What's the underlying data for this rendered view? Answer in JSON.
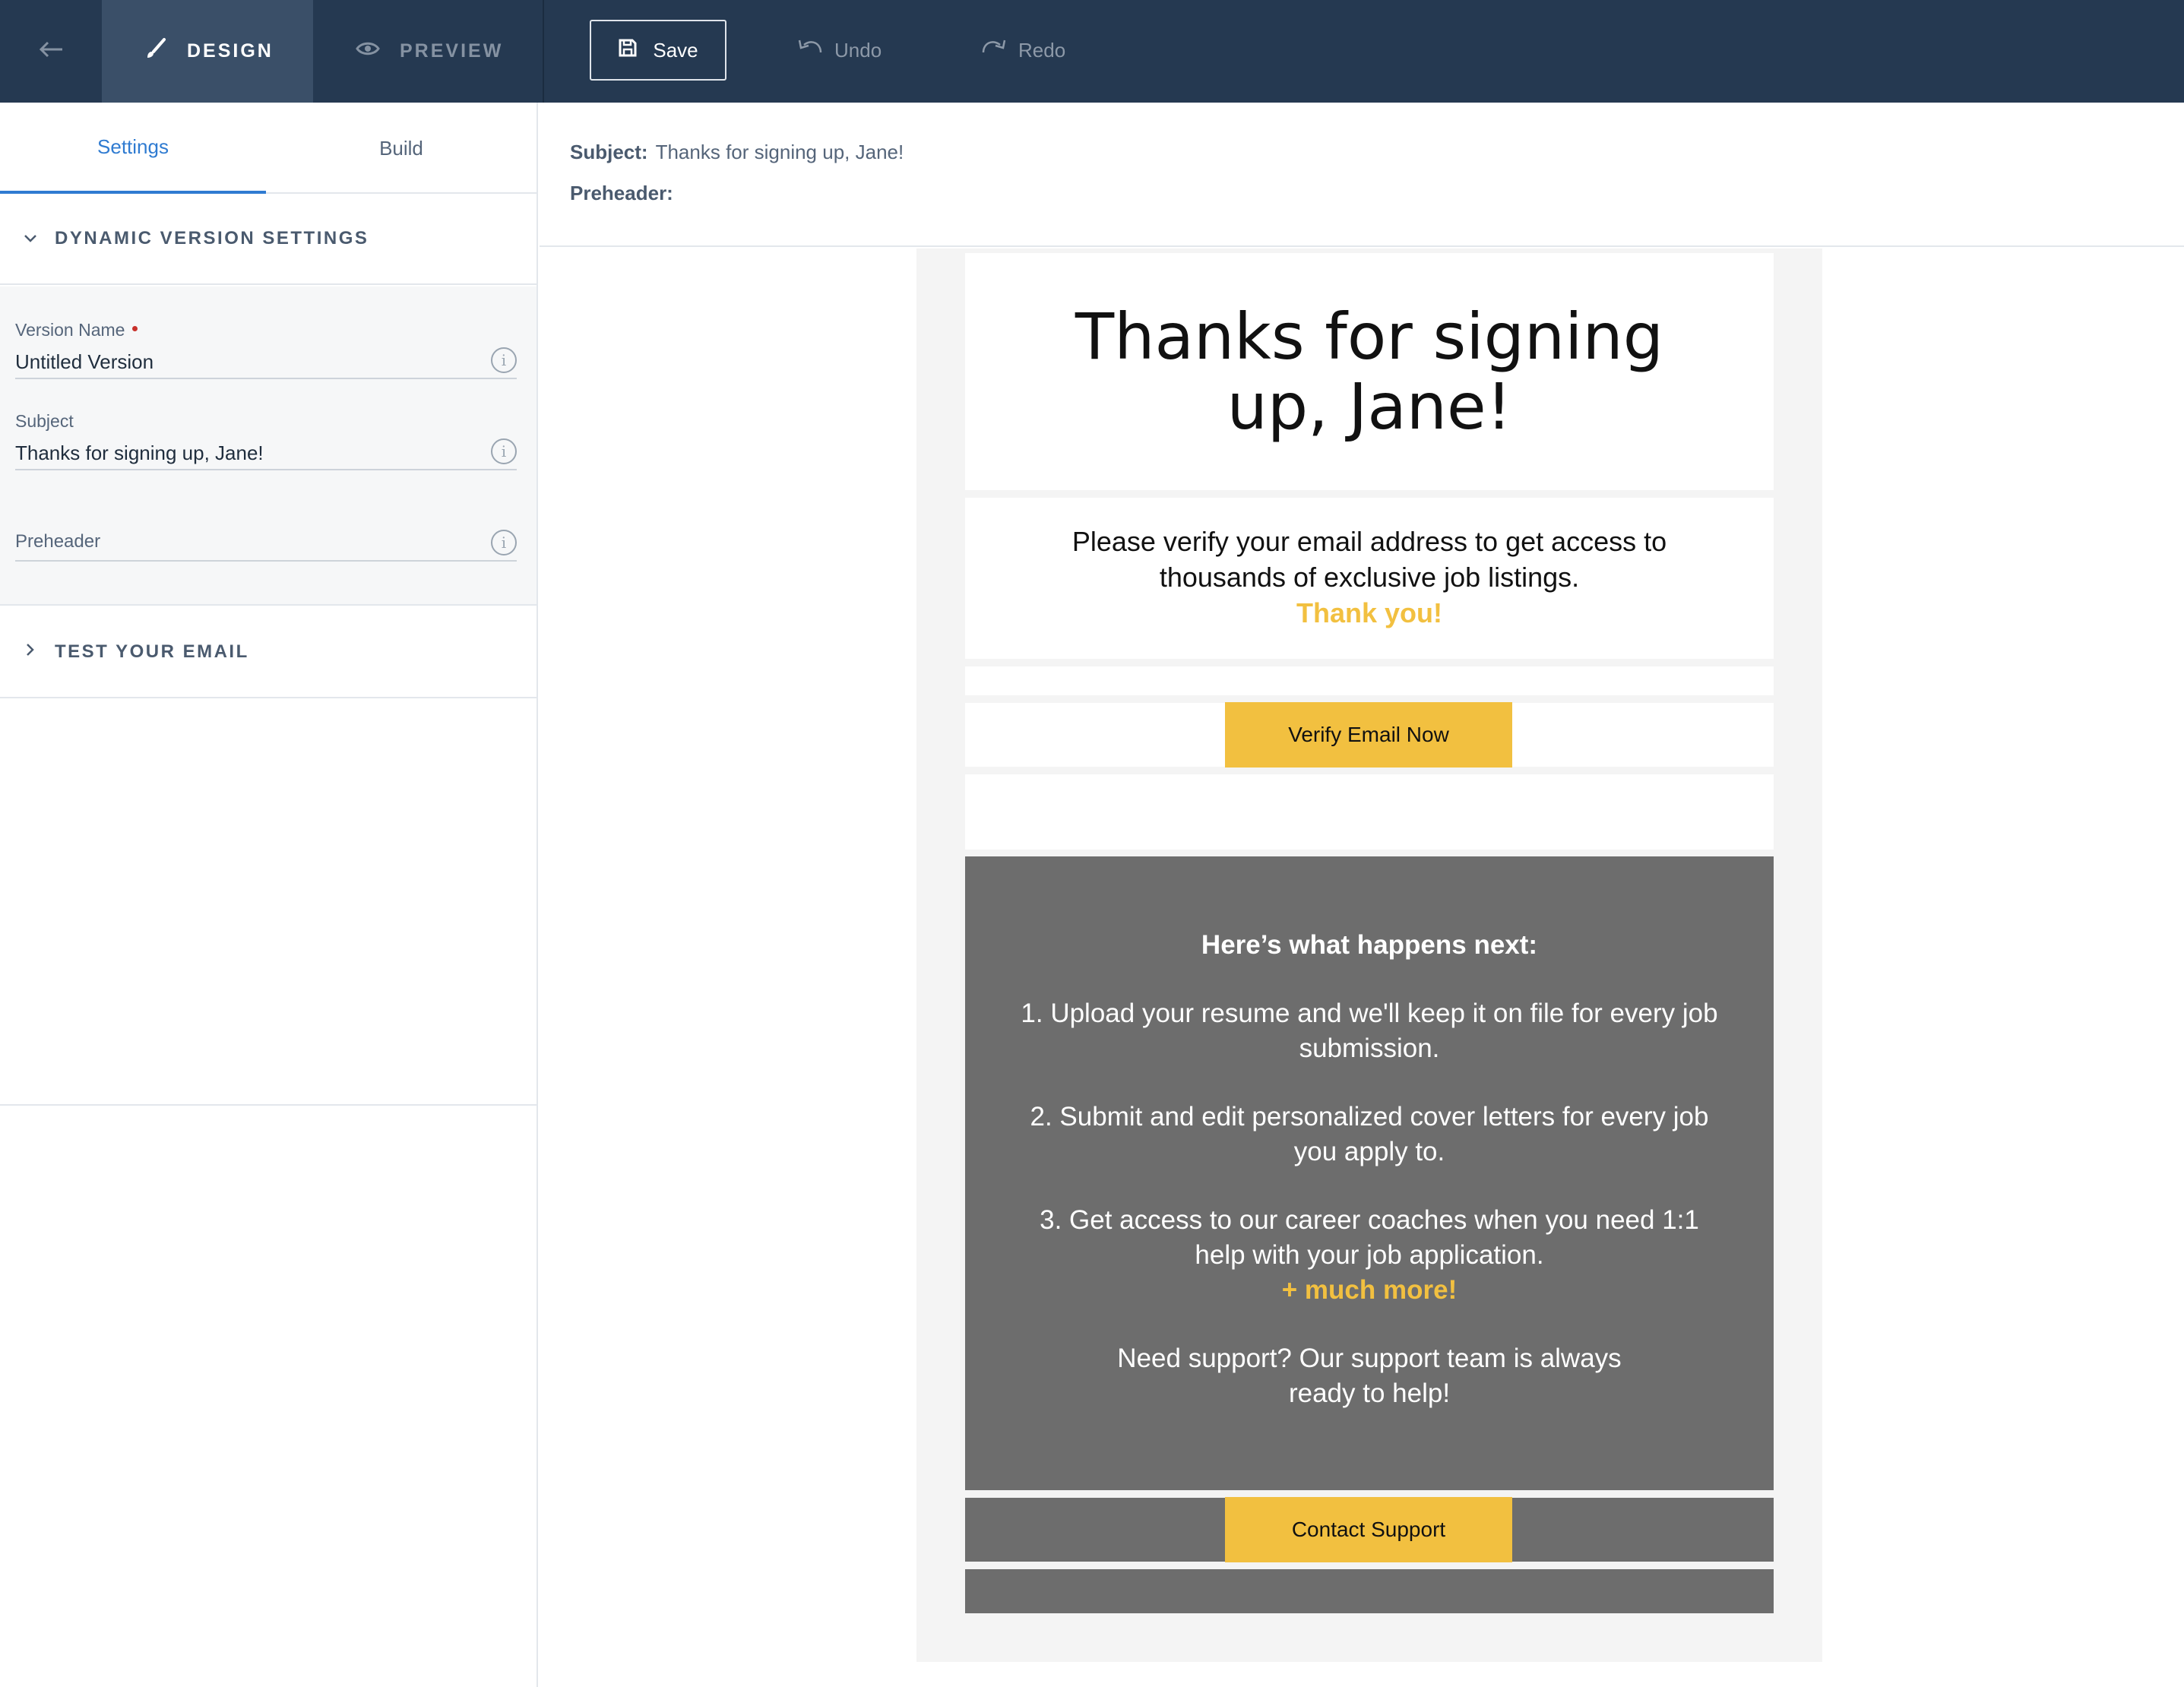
{
  "topbar": {
    "back_icon": "arrow-left-icon",
    "design_label": "DESIGN",
    "design_icon": "brush-icon",
    "preview_label": "PREVIEW",
    "preview_icon": "eye-icon",
    "save_label": "Save",
    "save_icon": "floppy-disk-icon",
    "undo_label": "Undo",
    "redo_label": "Redo"
  },
  "sidebar": {
    "tabs": [
      {
        "label": "Settings",
        "active": true
      },
      {
        "label": "Build",
        "active": false
      }
    ],
    "dynamic_section": {
      "title": "DYNAMIC VERSION SETTINGS",
      "expanded": true,
      "fields": [
        {
          "label": "Version Name",
          "value": "Untitled Version",
          "required": true
        },
        {
          "label": "Subject",
          "value": "Thanks for signing up, Jane!"
        },
        {
          "label": "Preheader",
          "value": ""
        }
      ]
    },
    "test_section": {
      "title": "TEST YOUR EMAIL",
      "expanded": false
    }
  },
  "meta": {
    "subject_label": "Subject:",
    "subject_value": "Thanks for signing up, Jane!",
    "preheader_label": "Preheader:"
  },
  "email": {
    "title": "Thanks for signing up, Jane!",
    "intro_line1": "Please verify your email address to get access to",
    "intro_line2": "thousands of exclusive job listings.",
    "thanks": "Thank you!",
    "verify_button": "Verify Email Now",
    "next_heading": "Here’s what happens next:",
    "steps": [
      "1. Upload your resume and we'll keep it on file for every job submission.",
      "2. Submit and edit personalized cover letters for every job you apply to.",
      "3. Get access to our career coaches when you need 1:1 help with your job application."
    ],
    "more": "+ much more!",
    "support_text": "Need support? Our support team is always ready to help!",
    "contact_button": "Contact Support"
  },
  "colors": {
    "topbar": "#253951",
    "accent": "#2f7bd1",
    "brand_yellow": "#f2c040",
    "email_dark": "#6d6d6d"
  }
}
